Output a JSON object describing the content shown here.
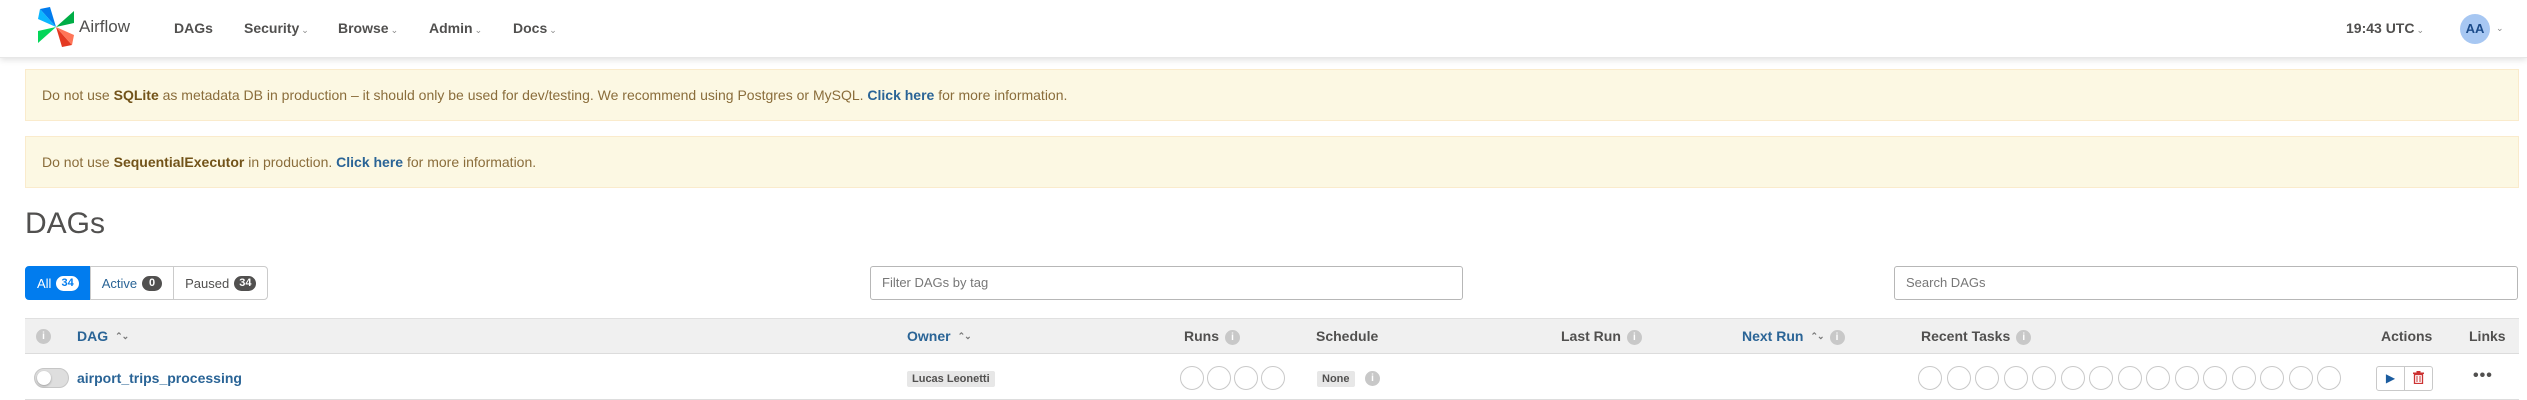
{
  "navbar": {
    "brand": "Airflow",
    "menu": [
      {
        "label": "DAGs",
        "caret": false
      },
      {
        "label": "Security",
        "caret": true
      },
      {
        "label": "Browse",
        "caret": true
      },
      {
        "label": "Admin",
        "caret": true
      },
      {
        "label": "Docs",
        "caret": true
      }
    ],
    "time": "19:43 UTC",
    "user_initials": "AA"
  },
  "alerts": [
    {
      "pre": "Do not use ",
      "strong": "SQLite",
      "mid": " as metadata DB in production – it should only be used for dev/testing. We recommend using Postgres or MySQL. ",
      "link": "Click here",
      "post": " for more information."
    },
    {
      "pre": "Do not use ",
      "strong": "SequentialExecutor",
      "mid": " in production. ",
      "link": "Click here",
      "post": " for more information."
    }
  ],
  "page_title": "DAGs",
  "filters": [
    {
      "label": "All",
      "count": "34",
      "active": true
    },
    {
      "label": "Active",
      "count": "0",
      "active": false
    },
    {
      "label": "Paused",
      "count": "34",
      "active": false
    }
  ],
  "tag_filter_placeholder": "Filter DAGs by tag",
  "search_placeholder": "Search DAGs",
  "table": {
    "headers": {
      "dag": "DAG",
      "owner": "Owner",
      "runs": "Runs",
      "schedule": "Schedule",
      "last_run": "Last Run",
      "next_run": "Next Run",
      "recent_tasks": "Recent Tasks",
      "actions": "Actions",
      "links": "Links"
    },
    "rows": [
      {
        "dag_id": "airport_trips_processing",
        "owner": "Lucas Leonetti",
        "schedule": "None",
        "paused": true
      }
    ]
  },
  "icons": {
    "info": "info-circle-icon",
    "sort": "sort-icon",
    "play": "play-icon",
    "delete": "trash-icon",
    "more": "ellipsis-icon",
    "caret": "chevron-down-icon"
  },
  "colors": {
    "primary": "#017cee",
    "link": "#2a6496",
    "alert_bg": "#fcf8e3",
    "alert_text": "#8a6d3b",
    "delete": "#cc3333"
  }
}
